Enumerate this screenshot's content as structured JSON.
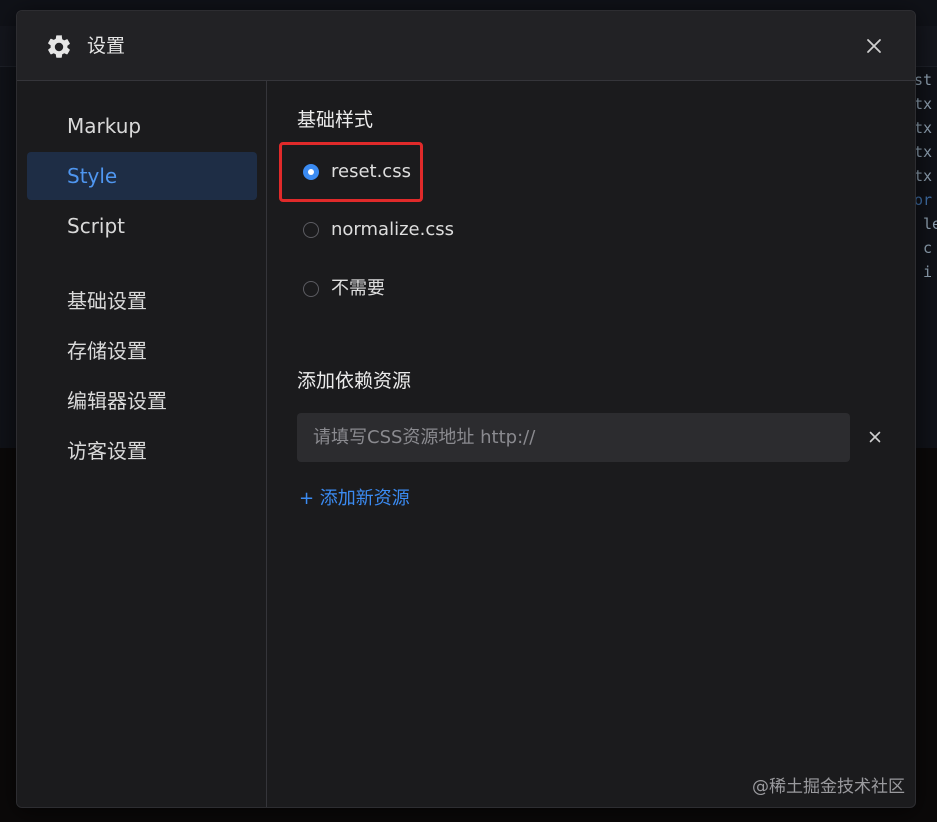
{
  "dialog": {
    "title": "设置",
    "icon": "gear-icon",
    "close_icon": "close-icon"
  },
  "sidebar": {
    "items": [
      {
        "label": "Markup",
        "active": false
      },
      {
        "label": "Style",
        "active": true
      },
      {
        "label": "Script",
        "active": false
      },
      {
        "label": "基础设置",
        "active": false
      },
      {
        "label": "存储设置",
        "active": false
      },
      {
        "label": "编辑器设置",
        "active": false
      },
      {
        "label": "访客设置",
        "active": false
      }
    ]
  },
  "style_section": {
    "title": "基础样式",
    "options": [
      {
        "label": "reset.css",
        "checked": true
      },
      {
        "label": "normalize.css",
        "checked": false
      },
      {
        "label": "不需要",
        "checked": false
      }
    ]
  },
  "resources": {
    "title": "添加依赖资源",
    "input_value": "",
    "input_placeholder": "请填写CSS资源地址 http://",
    "add_link": "+ 添加新资源"
  },
  "watermark": "@稀土掘金技术社区",
  "colors": {
    "accent": "#3b8bf2",
    "highlight": "#e02a2a",
    "active_nav_bg": "#1e2d45"
  }
}
